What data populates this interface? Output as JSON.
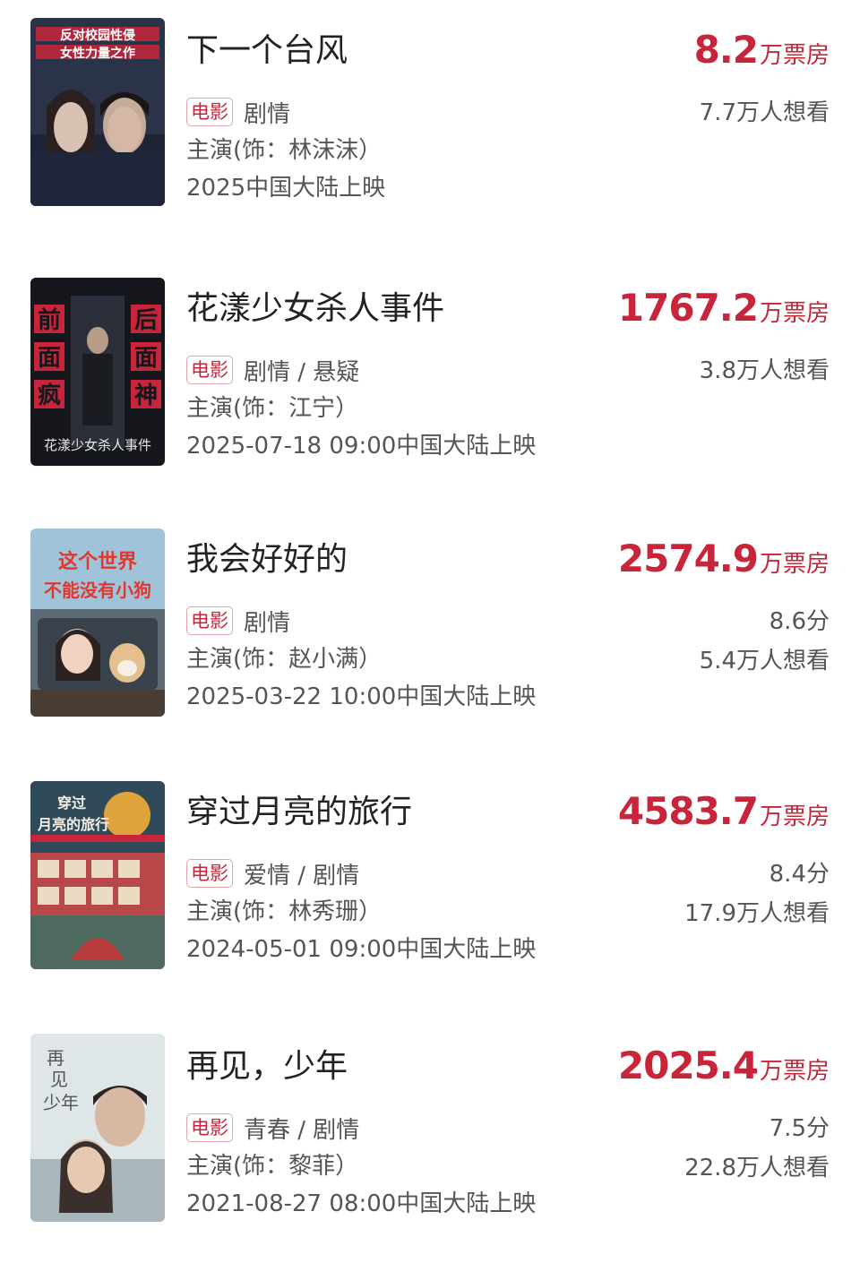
{
  "movies": [
    {
      "title": "下一个台风",
      "tag": "电影",
      "genre": "剧情",
      "cast": "主演(饰：林沫沫）",
      "release": "2025中国大陆上映",
      "box_office_value": "8.2",
      "box_office_unit": "万票房",
      "score": "",
      "want_to_see": "7.7万人想看",
      "poster_text": "反对校园性侵 女性力量之作"
    },
    {
      "title": "花漾少女杀人事件",
      "tag": "电影",
      "genre": "剧情 / 悬疑",
      "cast": "主演(饰：江宁）",
      "release": "2025-07-18 09:00中国大陆上映",
      "box_office_value": "1767.2",
      "box_office_unit": "万票房",
      "score": "",
      "want_to_see": "3.8万人想看",
      "poster_text": "前面疯 后面神"
    },
    {
      "title": "我会好好的",
      "tag": "电影",
      "genre": "剧情",
      "cast": "主演(饰：赵小满）",
      "release": "2025-03-22 10:00中国大陆上映",
      "box_office_value": "2574.9",
      "box_office_unit": "万票房",
      "score": "8.6分",
      "want_to_see": "5.4万人想看",
      "poster_text": "这个世界 不能没有小狗"
    },
    {
      "title": "穿过月亮的旅行",
      "tag": "电影",
      "genre": "爱情 / 剧情",
      "cast": "主演(饰：林秀珊）",
      "release": "2024-05-01 09:00中国大陆上映",
      "box_office_value": "4583.7",
      "box_office_unit": "万票房",
      "score": "8.4分",
      "want_to_see": "17.9万人想看",
      "poster_text": "穿过月亮的旅行"
    },
    {
      "title": "再见，少年",
      "tag": "电影",
      "genre": "青春 / 剧情",
      "cast": "主演(饰：黎菲）",
      "release": "2021-08-27 08:00中国大陆上映",
      "box_office_value": "2025.4",
      "box_office_unit": "万票房",
      "score": "7.5分",
      "want_to_see": "22.8万人想看",
      "poster_text": "再见少年"
    }
  ],
  "colors": {
    "accent": "#c8243a",
    "tag_border": "#e3a5ac",
    "title_text": "#222222",
    "meta_text": "#555555"
  }
}
